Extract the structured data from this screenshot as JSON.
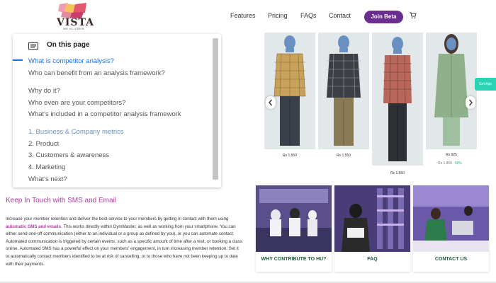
{
  "header": {
    "logo_text": "VISTA",
    "logo_sub": "WE KLICKER",
    "nav": [
      "Features",
      "Pricing",
      "FAQs",
      "Contact"
    ],
    "join_label": "Join Beta"
  },
  "toc": {
    "title": "On this page",
    "items": [
      "What is competitor analysis?",
      "Who can benefit from an analysis framework?",
      "Why do it?",
      "Who even are your competitors?",
      "What's included in a competitor analysis framework",
      "1. Business & Company metrics",
      "2. Product",
      "3. Customers & awareness",
      "4. Marketing",
      "What's next?"
    ]
  },
  "carousel": {
    "prices": [
      "Rs 1,550",
      "Rs 1,550",
      "Rs 1,550",
      "Rs 925"
    ],
    "old_price": "Rs 1,850",
    "discount": "-50%",
    "side_tab": "Get App"
  },
  "keep_in_touch": {
    "title": "Keep In Touch with SMS and Email",
    "body_1": "Increase your member retention and deliver the best service to your members by getting in contact with them using ",
    "body_highlight": "automatic SMS and emails",
    "body_2": ". This works directly within GymMaster, as well as working from your smartphone. You can either send one-off communication (either to an individual or a group as defined by you), or you can automate contact. Automated communication is triggered by certain events, such as a specific amount of time after a visit, or booking a class online. Automated SMS has a powerful effect on your members' engagement, in turn increasing member retention. Set it to automatically contact members identified to be at risk of cancelling, or to those who have not been keeping up to date with their payments."
  },
  "cards": [
    {
      "label": "WHY CONTRIBUTE TO HU?"
    },
    {
      "label": "FAQ"
    },
    {
      "label": "CONTACT US"
    }
  ],
  "colors": {
    "accent": "#6b2d8f",
    "link_blue": "#1a73e8",
    "pink": "#b03aa4",
    "card_label": "#1e5b3c"
  }
}
